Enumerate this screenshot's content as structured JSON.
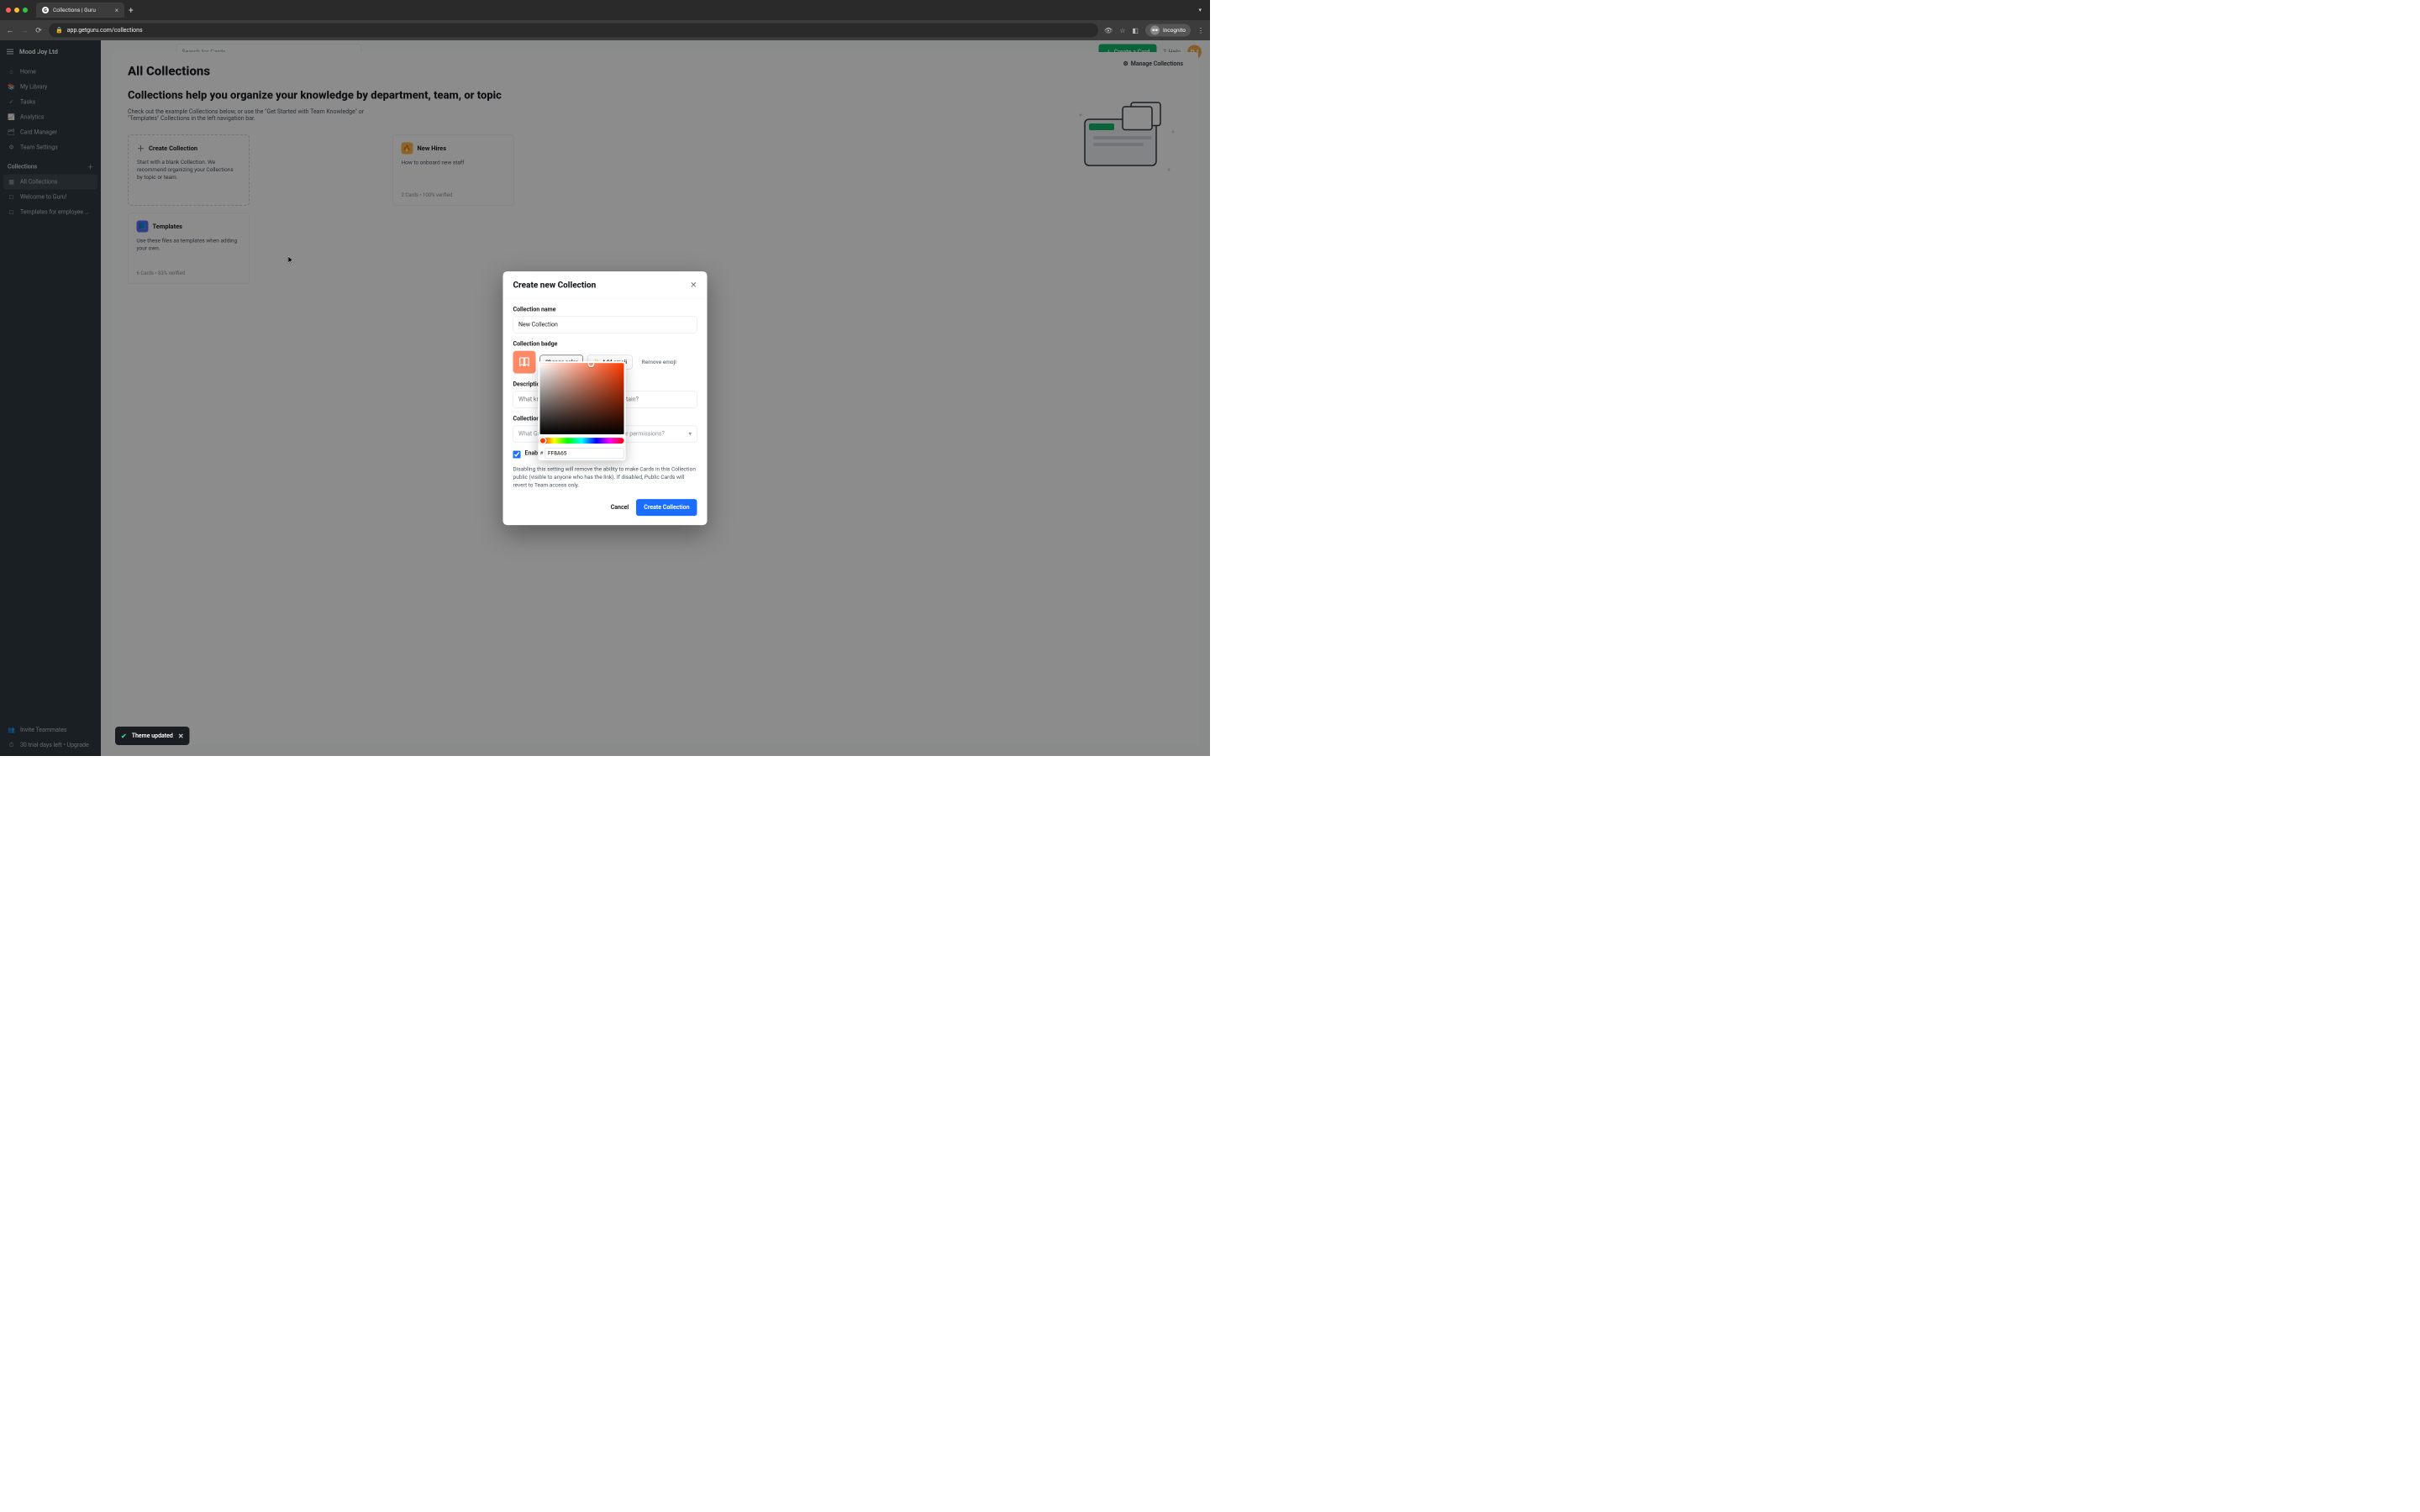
{
  "browser": {
    "tab_title": "Collections | Guru",
    "url": "app.getguru.com/collections",
    "incognito_label": "Incognito"
  },
  "app": {
    "workspace": "Mood Joy Ltd",
    "search_placeholder": "Search for Cards",
    "create_card_label": "Create a Card",
    "help_label": "Help",
    "avatar_initials": "DJ"
  },
  "sidebar": {
    "items": [
      {
        "icon": "home",
        "label": "Home"
      },
      {
        "icon": "library",
        "label": "My Library"
      },
      {
        "icon": "tasks",
        "label": "Tasks"
      },
      {
        "icon": "analytics",
        "label": "Analytics"
      },
      {
        "icon": "cardmgr",
        "label": "Card Manager"
      },
      {
        "icon": "settings",
        "label": "Team Settings"
      }
    ],
    "section_label": "Collections",
    "collections": [
      {
        "label": "All Collections",
        "active": true
      },
      {
        "label": "Welcome to Guru!",
        "active": false
      },
      {
        "label": "Templates for employee …",
        "active": false
      }
    ],
    "footer": {
      "invite_label": "Invite Teammates",
      "trial_label": "30 trial days left • Upgrade"
    }
  },
  "page": {
    "title": "All Collections",
    "manage_label": "Manage Collections",
    "headline": "Collections help you organize your knowledge by department, team, or topic",
    "subtext": "Check out the example Collections below, or use the \"Get Started with Team Knowledge\" or \"Templates\" Collections in the left navigation bar.",
    "cards": [
      {
        "kind": "create",
        "title": "Create Collection",
        "desc": "Start with a blank Collection. We recommend organizing your Collections by topic or team.",
        "meta": ""
      },
      {
        "kind": "col",
        "badge_color": "#f8b84e",
        "badge_emoji": "🔥",
        "title": "New Hires",
        "desc": "How to onboard new staff",
        "meta": "2 Cards • 100% verified"
      },
      {
        "kind": "col",
        "badge_color": "#5b6cff",
        "badge_emoji": "📘",
        "title": "Templates",
        "desc": "Use these files as templates when adding your own.",
        "meta": "6 Cards • 83% verified"
      }
    ]
  },
  "modal": {
    "title": "Create new Collection",
    "name_label": "Collection name",
    "name_value": "New Collection",
    "badge_label": "Collection badge",
    "change_color_label": "Change color",
    "add_emoji_label": "Add emoji",
    "remove_emoji_label": "Remove emoji",
    "description_label": "Description",
    "description_placeholder": "What knowledge does this Collection contain?",
    "owner_label": "Collection Owner",
    "owner_placeholder": "What Group should have Collection Owner permissions?",
    "enable_label": "Enable Public Cards",
    "enable_help": "Disabling this setting will remove the ability to make Cards in this Collection public (visible to anyone who has the link). If disabled, Public Cards will revert to Team access only.",
    "cancel_label": "Cancel",
    "submit_label": "Create Collection"
  },
  "color_picker": {
    "hex_value": "FF8A65",
    "badge_color": "#FF8A65"
  },
  "toast": {
    "message": "Theme updated"
  }
}
